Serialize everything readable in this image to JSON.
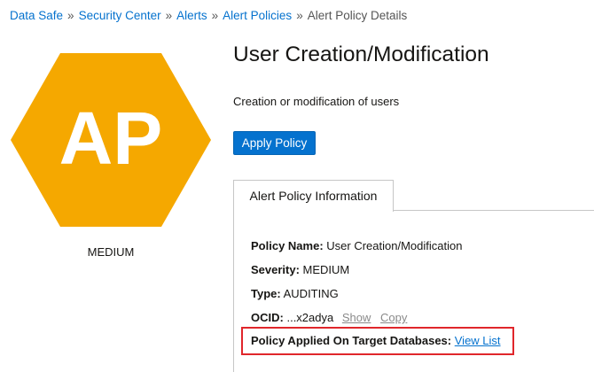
{
  "breadcrumb": {
    "items": [
      "Data Safe",
      "Security Center",
      "Alerts",
      "Alert Policies"
    ],
    "current": "Alert Policy Details",
    "separator": "»"
  },
  "badge": {
    "initials": "AP",
    "caption": "MEDIUM",
    "color": "#f5a800",
    "text_color": "#ffffff"
  },
  "header": {
    "title": "User Creation/Modification",
    "description": "Creation or modification of users",
    "apply_button_label": "Apply Policy"
  },
  "tabs": [
    {
      "label": "Alert Policy Information",
      "active": true
    }
  ],
  "info": {
    "policy_name_label": "Policy Name:",
    "policy_name_value": "User Creation/Modification",
    "severity_label": "Severity:",
    "severity_value": "MEDIUM",
    "type_label": "Type:",
    "type_value": "AUDITING",
    "ocid_label": "OCID:",
    "ocid_value": "...x2adya",
    "ocid_show": "Show",
    "ocid_copy": "Copy",
    "applied_label": "Policy Applied On Target Databases:",
    "applied_link": "View List"
  },
  "colors": {
    "link": "#0572ce",
    "primary_button": "#0572ce",
    "highlight_border": "#e0262b"
  }
}
